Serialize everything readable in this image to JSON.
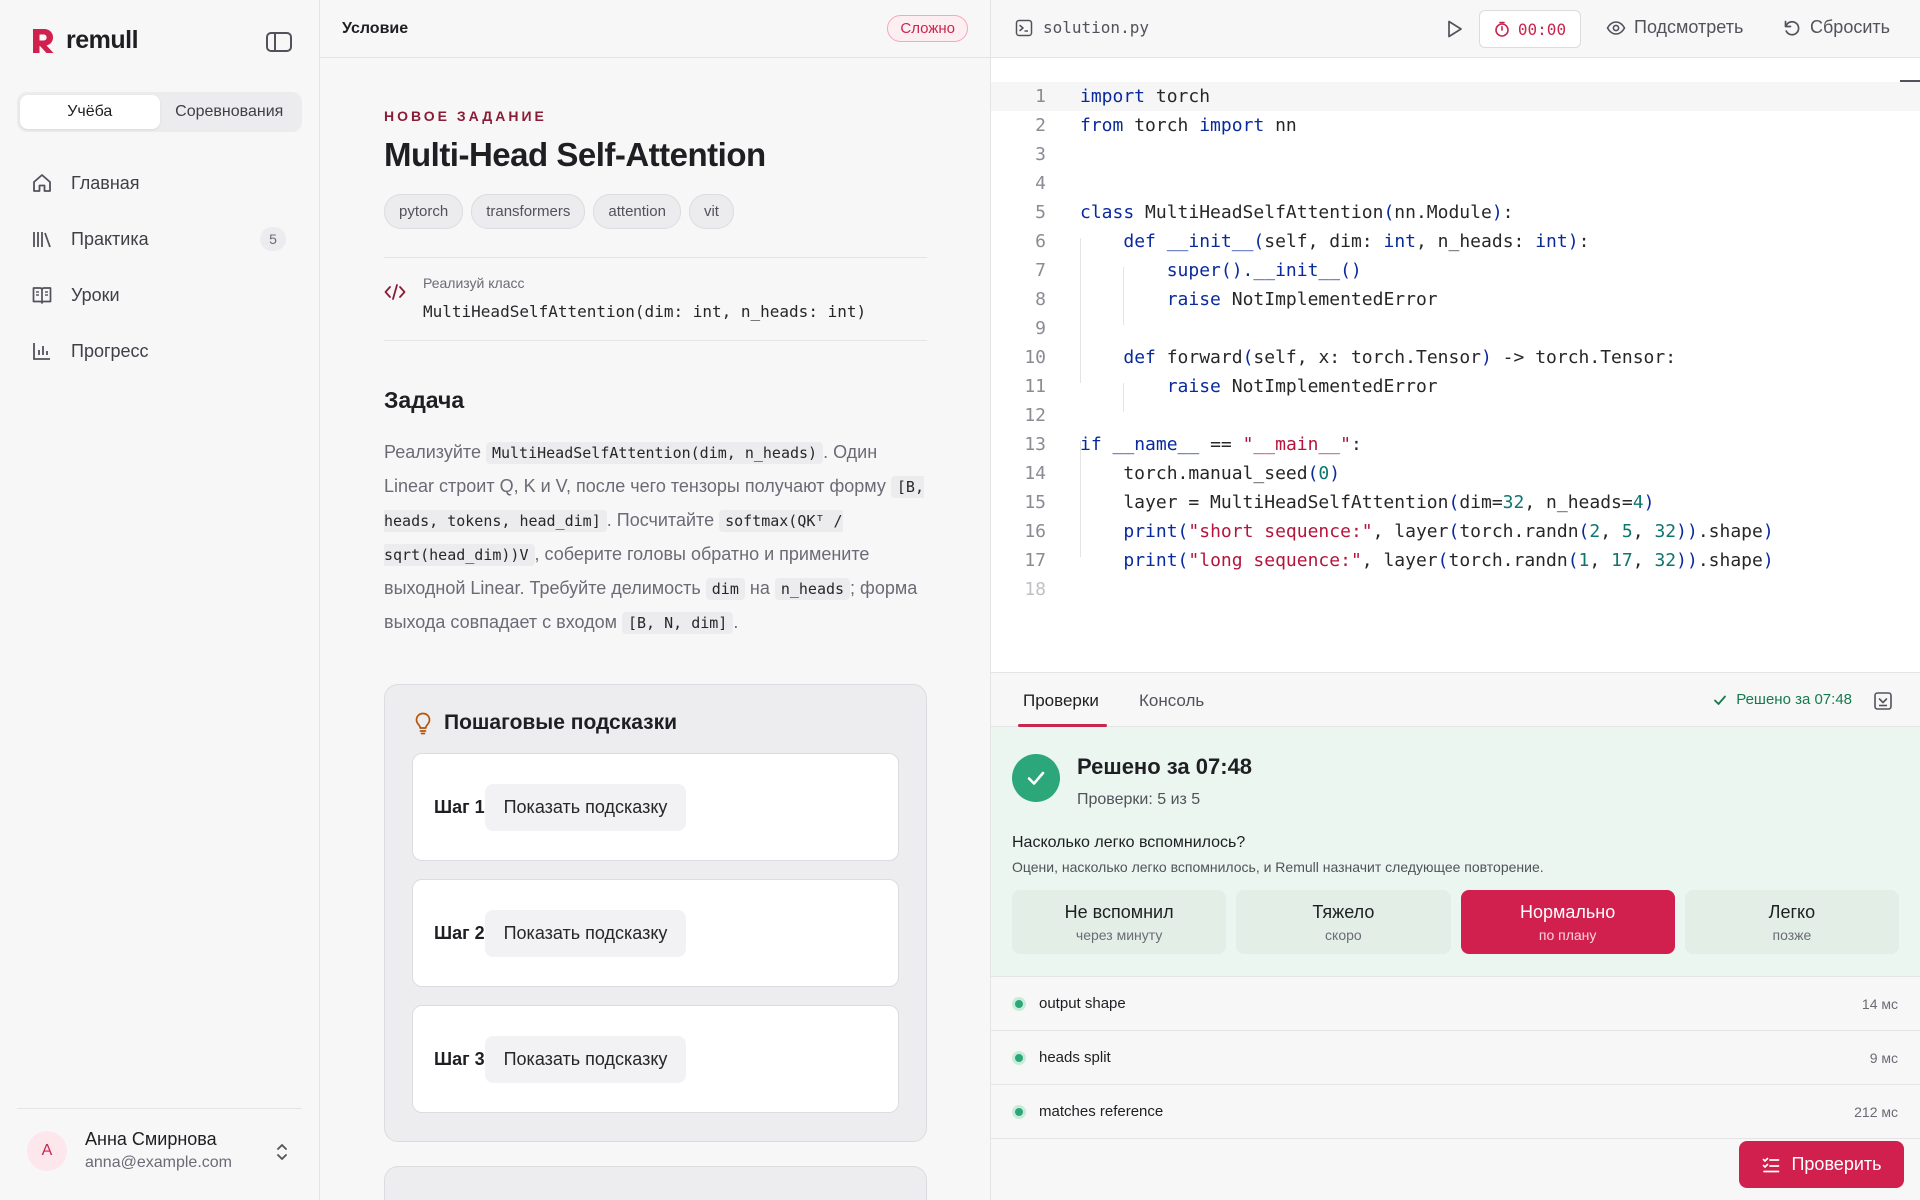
{
  "app": {
    "name": "remull",
    "brand_color": "#d11f4e"
  },
  "sidebar": {
    "segments": [
      {
        "label": "Учёба",
        "active": true
      },
      {
        "label": "Соревнования",
        "active": false
      }
    ],
    "nav": [
      {
        "label": "Главная",
        "icon": "home-icon"
      },
      {
        "label": "Практика",
        "icon": "library-icon",
        "badge": "5"
      },
      {
        "label": "Уроки",
        "icon": "book-icon"
      },
      {
        "label": "Прогресс",
        "icon": "chart-icon"
      }
    ],
    "user": {
      "initial": "A",
      "name": "Анна Смирнова",
      "email": "anna@example.com"
    }
  },
  "problem": {
    "header_title": "Условие",
    "difficulty": "Сложно",
    "eyebrow": "НОВОЕ ЗАДАНИЕ",
    "title": "Multi-Head Self-Attention",
    "tags": [
      "pytorch",
      "transformers",
      "attention",
      "vit"
    ],
    "signature_label": "Реализуй класс",
    "signature": "MultiHeadSelfAttention(dim: int, n_heads: int)",
    "task_heading": "Задача",
    "description": {
      "t1": "Реализуйте ",
      "c1": "MultiHeadSelfAttention(dim, n_heads)",
      "t2": ". Один Linear строит Q, K и V, после чего тензоры получают форму ",
      "c2": "[B, heads, tokens, head_dim]",
      "t3": ". Посчитайте ",
      "c3": "softmax(QKᵀ / sqrt(head_dim))V",
      "t4": ", соберите головы обратно и примените выходной Linear. Требуйте делимость ",
      "c4": "dim",
      "t5": " на ",
      "c5": "n_heads",
      "t6": "; форма выхода совпадает с входом ",
      "c6": "[B, N, dim]",
      "t7": "."
    },
    "hints_title": "Пошаговые подсказки",
    "steps": [
      {
        "label": "Шаг 1",
        "button": "Показать подсказку"
      },
      {
        "label": "Шаг 2",
        "button": "Показать подсказку"
      },
      {
        "label": "Шаг 3",
        "button": "Показать подсказку"
      }
    ]
  },
  "editor": {
    "filename": "solution.py",
    "timer": "00:00",
    "preview_label": "Подсмотреть",
    "reset_label": "Сбросить",
    "line_numbers": [
      "1",
      "2",
      "3",
      "4",
      "5",
      "6",
      "7",
      "8",
      "9",
      "10",
      "11",
      "12",
      "13",
      "14",
      "15",
      "16",
      "17",
      "18"
    ],
    "code_lines": [
      "import torch",
      "from torch import nn",
      "",
      "",
      "class MultiHeadSelfAttention(nn.Module):",
      "    def __init__(self, dim: int, n_heads: int):",
      "        super().__init__()",
      "        raise NotImplementedError",
      "",
      "    def forward(self, x: torch.Tensor) -> torch.Tensor:",
      "        raise NotImplementedError",
      "",
      "if __name__ == \"__main__\":",
      "    torch.manual_seed(0)",
      "    layer = MultiHeadSelfAttention(dim=32, n_heads=4)",
      "    print(\"short sequence:\", layer(torch.randn(2, 5, 32)).shape)",
      "    print(\"long sequence:\", layer(torch.randn(1, 17, 32)).shape)",
      ""
    ]
  },
  "results": {
    "tabs": [
      "Проверки",
      "Консоль"
    ],
    "solved_short": "Решено за 07:48",
    "title": "Решено за 07:48",
    "subtitle": "Проверки: 5 из 5",
    "question": "Насколько легко вспомнилось?",
    "question_sub": "Оцени, насколько легко вспомнилось, и Remull назначит следующее повторение.",
    "ratings": [
      {
        "label": "Не вспомнил",
        "sub": "через минуту",
        "selected": false
      },
      {
        "label": "Тяжело",
        "sub": "скоро",
        "selected": false
      },
      {
        "label": "Нормально",
        "sub": "по плану",
        "selected": true
      },
      {
        "label": "Легко",
        "sub": "позже",
        "selected": false
      }
    ],
    "checks": [
      {
        "name": "output shape",
        "time": "14 мс"
      },
      {
        "name": "heads split",
        "time": "9 мс"
      },
      {
        "name": "matches reference",
        "time": "212 мс"
      }
    ],
    "check_button": "Проверить"
  }
}
